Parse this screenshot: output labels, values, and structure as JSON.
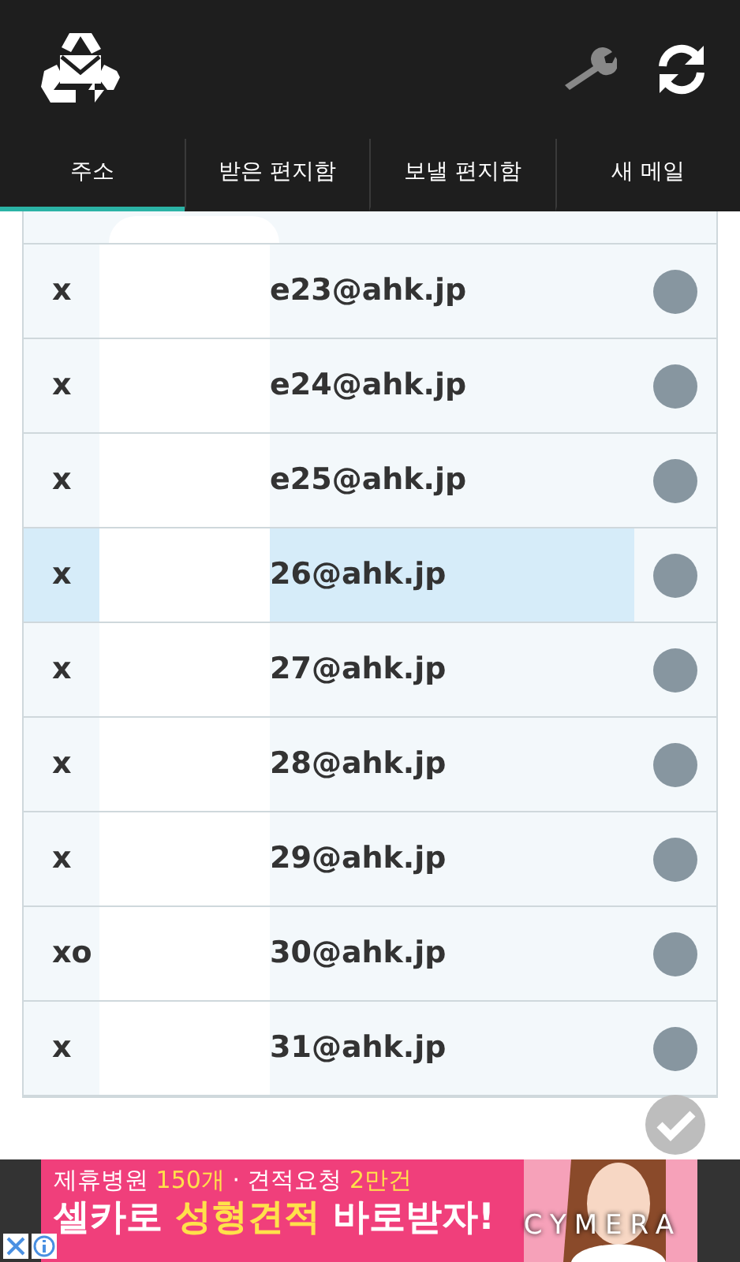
{
  "tabs": [
    {
      "label": "주소",
      "selected": true
    },
    {
      "label": "받은 편지함",
      "selected": false
    },
    {
      "label": "보낼 편지함",
      "selected": false
    },
    {
      "label": "새 메일",
      "selected": false
    }
  ],
  "rows": [
    {
      "head": "x",
      "tail": "e23@ahk.jp",
      "selected": false,
      "checked": false
    },
    {
      "head": "x",
      "tail": "e24@ahk.jp",
      "selected": false,
      "checked": false
    },
    {
      "head": "x",
      "tail": "e25@ahk.jp",
      "selected": false,
      "checked": false
    },
    {
      "head": "x",
      "tail": "26@ahk.jp",
      "selected": true,
      "checked": false
    },
    {
      "head": "x",
      "tail": "27@ahk.jp",
      "selected": false,
      "checked": false
    },
    {
      "head": "x",
      "tail": "28@ahk.jp",
      "selected": false,
      "checked": false
    },
    {
      "head": "x",
      "tail": "29@ahk.jp",
      "selected": false,
      "checked": false
    },
    {
      "head": "xo",
      "tail": "30@ahk.jp",
      "selected": false,
      "checked": false
    },
    {
      "head": "x",
      "tail": "31@ahk.jp",
      "selected": false,
      "checked": false
    }
  ],
  "ad": {
    "line1": [
      {
        "text": "제휴병원",
        "highlight": false
      },
      {
        "text": "150개",
        "highlight": true
      },
      {
        "text": "· 견적요청",
        "highlight": false
      },
      {
        "text": "2만건",
        "highlight": true
      }
    ],
    "line2": [
      {
        "text": "셀카로",
        "highlight": false
      },
      {
        "text": "성형견적",
        "highlight": true
      },
      {
        "text": "바로받자!",
        "highlight": false
      }
    ],
    "brand": "CYMERA"
  }
}
